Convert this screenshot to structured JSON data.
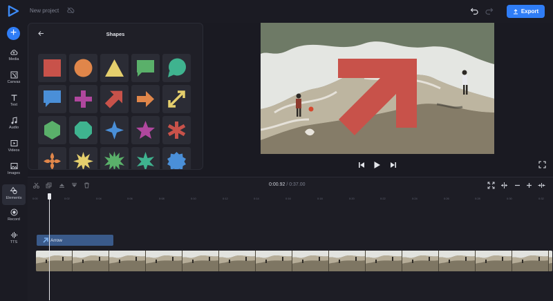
{
  "header": {
    "project_name": "New project",
    "export_label": "Export"
  },
  "sidebar": {
    "items": [
      {
        "label": "Media",
        "icon": "cloud-upload-icon"
      },
      {
        "label": "Canvas",
        "icon": "canvas-icon"
      },
      {
        "label": "Text",
        "icon": "text-icon"
      },
      {
        "label": "Audio",
        "icon": "music-note-icon"
      },
      {
        "label": "Videos",
        "icon": "video-icon"
      },
      {
        "label": "Images",
        "icon": "image-icon"
      },
      {
        "label": "Elements",
        "icon": "shapes-icon",
        "active": true
      },
      {
        "label": "Record",
        "icon": "record-icon"
      },
      {
        "label": "TTS",
        "icon": "waveform-icon"
      }
    ]
  },
  "panel": {
    "title": "Shapes"
  },
  "timeline": {
    "current_time": "0:00.92",
    "total_time": "/ 0:37.00",
    "ruler_ticks": [
      "0:00",
      "0:02",
      "0:04",
      "0:06",
      "0:08",
      "0:10",
      "0:12",
      "0:14",
      "0:16",
      "0:18",
      "0:20",
      "0:22",
      "0:24",
      "0:26",
      "0:28",
      "0:30",
      "0:32"
    ],
    "arrow_clip_label": "Arrow"
  },
  "colors": {
    "accent": "#2f7df6",
    "red": "#c8524a",
    "orange": "#e0864a",
    "yellow": "#e5cf6d",
    "green": "#5ab06a",
    "teal": "#3fb38f",
    "blue": "#4a8fd8",
    "purple": "#b0479e"
  }
}
